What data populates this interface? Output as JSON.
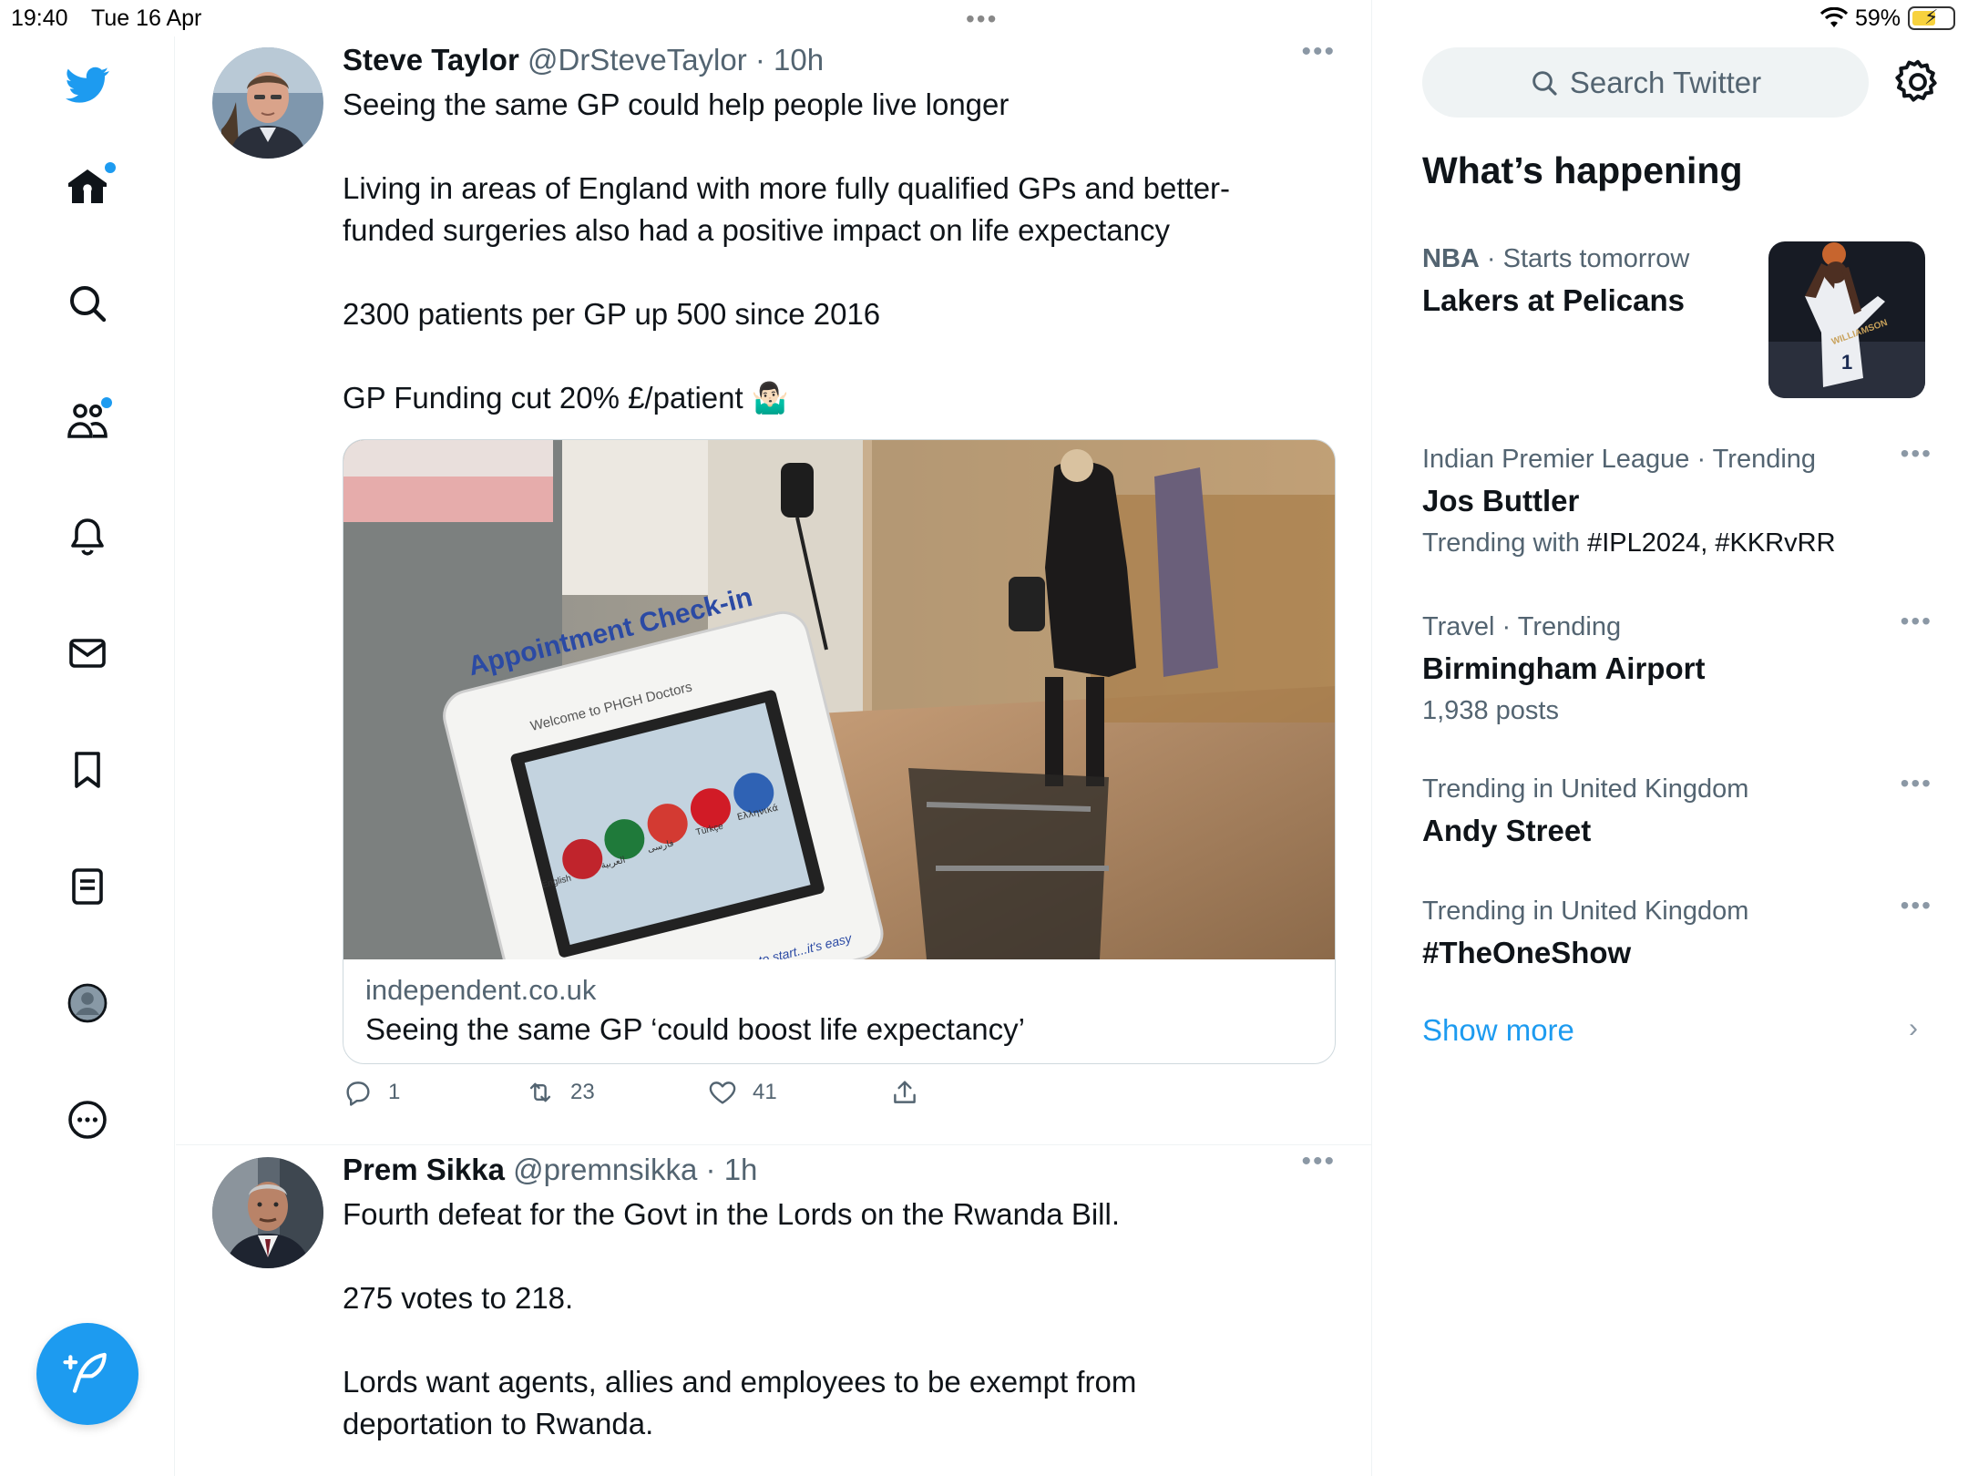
{
  "status_bar": {
    "time": "19:40",
    "date": "Tue 16 Apr",
    "battery": "59%",
    "battery_level": 0.59
  },
  "nav": {
    "items": [
      "twitter-logo",
      "home",
      "explore",
      "communities",
      "notifications",
      "messages",
      "bookmarks",
      "lists",
      "profile",
      "more"
    ],
    "accent": "#1d9bf0"
  },
  "timeline": {
    "tweets": [
      {
        "name": "Steve Taylor",
        "meta": "@DrSteveTaylor · 10h",
        "lines": [
          "Seeing the same GP could help people live longer",
          "",
          "Living in areas of England with more fully qualified GPs and better-",
          "funded surgeries also had a positive impact on life expectancy",
          "",
          "2300 patients per GP up 500 since 2016",
          "",
          "GP Funding cut 20% £/patient 🤷🏻‍♂️"
        ],
        "card": {
          "image_caption": "Appointment Check-in",
          "image_subtitle": "Welcome to PHGH Doctors",
          "image_footer": "Touch the screen to start...it's easy",
          "lang_labels": [
            "English",
            "العربية",
            "فارسی",
            "Türkçe",
            "Ελληνικά"
          ],
          "domain": "independent.co.uk",
          "title": "Seeing the same GP ‘could boost life expectancy’"
        },
        "actions": {
          "replies": "1",
          "retweets": "23",
          "likes": "41"
        }
      },
      {
        "name": "Prem Sikka",
        "meta": "@premnsikka · 1h",
        "lines": [
          "Fourth defeat for the Govt in the Lords on the Rwanda Bill.",
          "",
          "275 votes to 218.",
          "",
          "Lords want agents, allies and  employees to be exempt from",
          "deportation to Rwanda."
        ]
      }
    ]
  },
  "sidebar": {
    "search_placeholder": "Search Twitter",
    "section_title": "What’s happening",
    "trends": [
      {
        "category": "NBA",
        "context": " · Starts tomorrow",
        "title": "Lakers at Pelicans",
        "sub": "",
        "thumb_jersey": "WILLIAMSON"
      },
      {
        "category": "Indian Premier League · Trending",
        "context": "",
        "title": "Jos Buttler",
        "sub_prefix": "Trending with ",
        "sub": "#IPL2024, #KKRvRR"
      },
      {
        "category": "Travel · Trending",
        "context": "",
        "title": "Birmingham Airport",
        "sub": "1,938 posts"
      },
      {
        "category": "Trending in United Kingdom",
        "context": "",
        "title": "Andy Street",
        "sub": ""
      },
      {
        "category": "Trending in United Kingdom",
        "context": "",
        "title": "#TheOneShow",
        "sub": ""
      }
    ],
    "show_more": "Show more"
  }
}
